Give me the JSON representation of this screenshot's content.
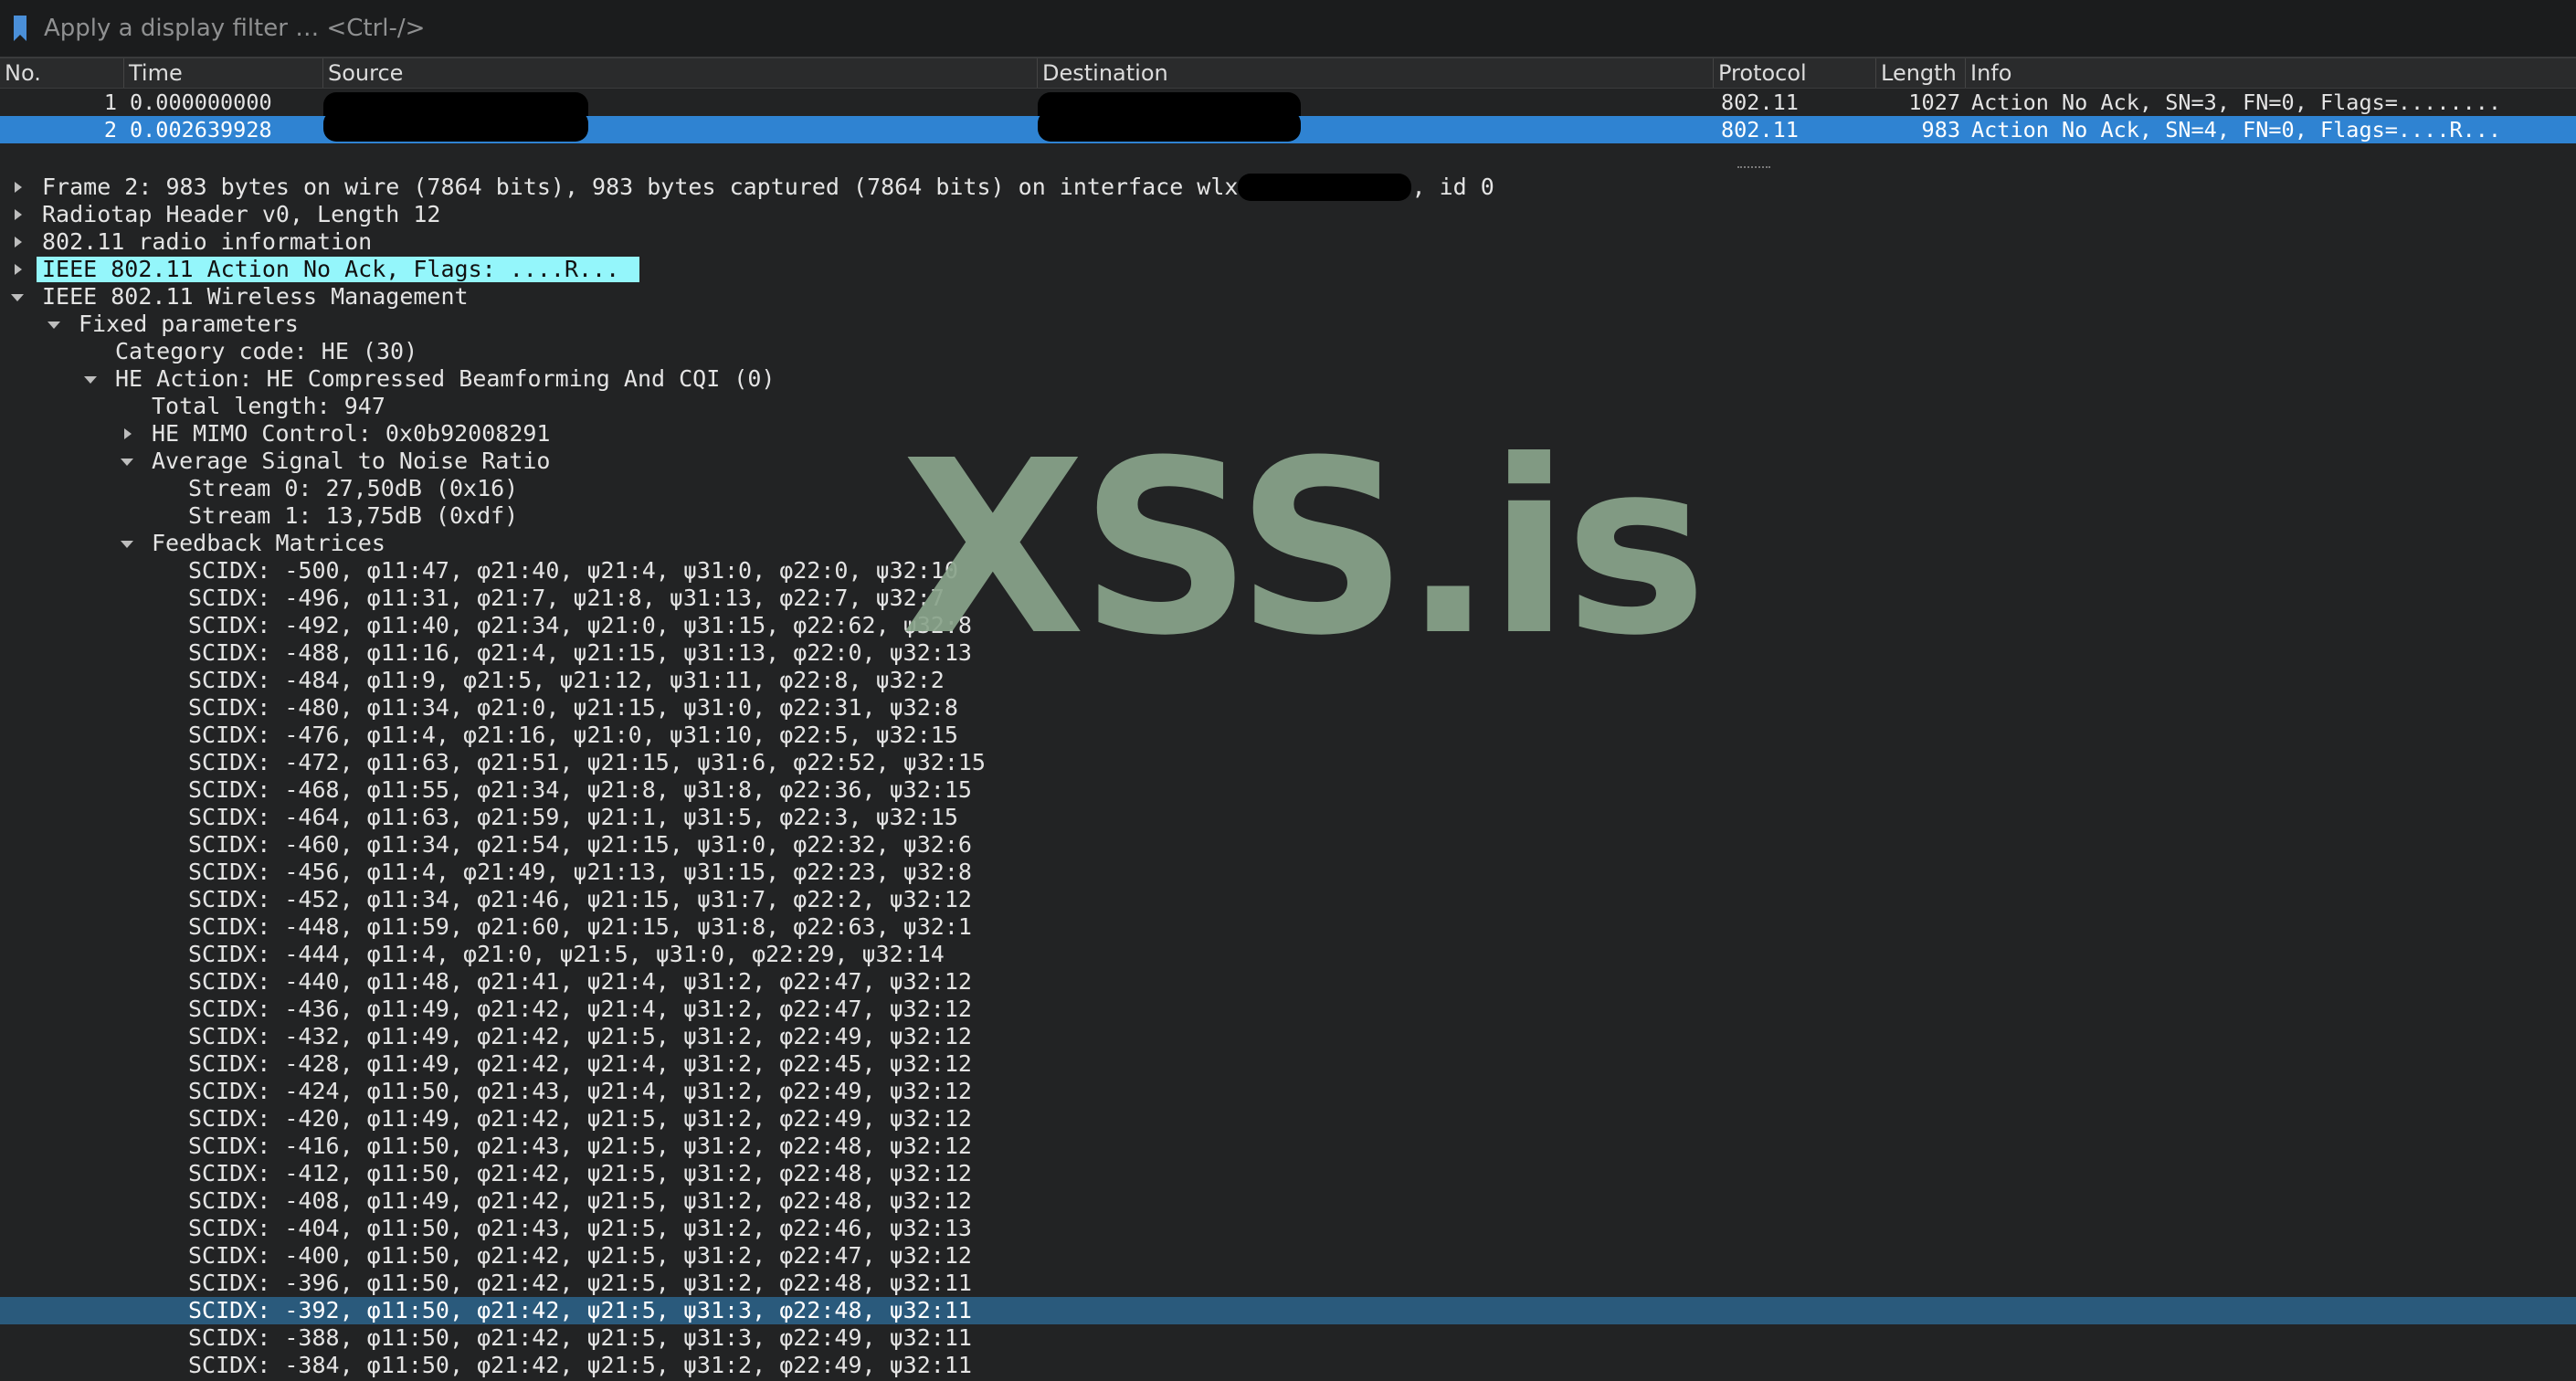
{
  "filter": {
    "placeholder": "Apply a display filter … <Ctrl-/>",
    "icon": "bookmark-icon"
  },
  "packet_list": {
    "columns": [
      "No.",
      "Time",
      "Source",
      "Destination",
      "Protocol",
      "Length",
      "Info"
    ],
    "rows": [
      {
        "no": "1",
        "time": "0.000000000",
        "source": "",
        "destination": "",
        "protocol": "802.11",
        "length": "1027",
        "info": "Action No Ack, SN=3, FN=0, Flags=........"
      },
      {
        "no": "2",
        "time": "0.002639928",
        "source": "",
        "destination": "",
        "protocol": "802.11",
        "length": "983",
        "info": "Action No Ack, SN=4, FN=0, Flags=....R..."
      }
    ]
  },
  "details": {
    "frame": "Frame 2: 983 bytes on wire (7864 bits), 983 bytes captured (7864 bits) on interface wlx",
    "frame_suffix": ", id 0",
    "radiotap": "Radiotap Header v0, Length 12",
    "radio_info": "802.11 radio information",
    "action": "IEEE 802.11 Action No Ack, Flags: ....R...",
    "wireless_mgmt": "IEEE 802.11 Wireless Management",
    "fixed_params": "Fixed parameters",
    "category": "Category code: HE (30)",
    "he_action": "HE Action: HE Compressed Beamforming And CQI (0)",
    "total_length": "Total length: 947",
    "mimo_control": "HE MIMO Control: 0x0b92008291",
    "avg_snr": "Average Signal to Noise Ratio",
    "stream0": "Stream 0: 27,50dB (0x16)",
    "stream1": "Stream 1: 13,75dB (0xdf)",
    "feedback": "Feedback Matrices",
    "scidx": [
      "SCIDX: -500, φ11:47, φ21:40, ψ21:4, ψ31:0, φ22:0, ψ32:10",
      "SCIDX: -496, φ11:31, φ21:7, ψ21:8, ψ31:13, φ22:7, ψ32:7",
      "SCIDX: -492, φ11:40, φ21:34, ψ21:0, ψ31:15, φ22:62, ψ32:8",
      "SCIDX: -488, φ11:16, φ21:4, ψ21:15, ψ31:13, φ22:0, ψ32:13",
      "SCIDX: -484, φ11:9, φ21:5, ψ21:12, ψ31:11, φ22:8, ψ32:2",
      "SCIDX: -480, φ11:34, φ21:0, ψ21:15, ψ31:0, φ22:31, ψ32:8",
      "SCIDX: -476, φ11:4, φ21:16, ψ21:0, ψ31:10, φ22:5, ψ32:15",
      "SCIDX: -472, φ11:63, φ21:51, ψ21:15, ψ31:6, φ22:52, ψ32:15",
      "SCIDX: -468, φ11:55, φ21:34, ψ21:8, ψ31:8, φ22:36, ψ32:15",
      "SCIDX: -464, φ11:63, φ21:59, ψ21:1, ψ31:5, φ22:3, ψ32:15",
      "SCIDX: -460, φ11:34, φ21:54, ψ21:15, ψ31:0, φ22:32, ψ32:6",
      "SCIDX: -456, φ11:4, φ21:49, ψ21:13, ψ31:15, φ22:23, ψ32:8",
      "SCIDX: -452, φ11:34, φ21:46, ψ21:15, ψ31:7, φ22:2, ψ32:12",
      "SCIDX: -448, φ11:59, φ21:60, ψ21:15, ψ31:8, φ22:63, ψ32:1",
      "SCIDX: -444, φ11:4, φ21:0, ψ21:5, ψ31:0, φ22:29, ψ32:14",
      "SCIDX: -440, φ11:48, φ21:41, ψ21:4, ψ31:2, φ22:47, ψ32:12",
      "SCIDX: -436, φ11:49, φ21:42, ψ21:4, ψ31:2, φ22:47, ψ32:12",
      "SCIDX: -432, φ11:49, φ21:42, ψ21:5, ψ31:2, φ22:49, ψ32:12",
      "SCIDX: -428, φ11:49, φ21:42, ψ21:4, ψ31:2, φ22:45, ψ32:12",
      "SCIDX: -424, φ11:50, φ21:43, ψ21:4, ψ31:2, φ22:49, ψ32:12",
      "SCIDX: -420, φ11:49, φ21:42, ψ21:5, ψ31:2, φ22:49, ψ32:12",
      "SCIDX: -416, φ11:50, φ21:43, ψ21:5, ψ31:2, φ22:48, ψ32:12",
      "SCIDX: -412, φ11:50, φ21:42, ψ21:5, ψ31:2, φ22:48, ψ32:12",
      "SCIDX: -408, φ11:49, φ21:42, ψ21:5, ψ31:2, φ22:48, ψ32:12",
      "SCIDX: -404, φ11:50, φ21:43, ψ21:5, ψ31:2, φ22:46, ψ32:13",
      "SCIDX: -400, φ11:50, φ21:42, ψ21:5, ψ31:2, φ22:47, ψ32:12",
      "SCIDX: -396, φ11:50, φ21:42, ψ21:5, ψ31:2, φ22:48, ψ32:11",
      "SCIDX: -392, φ11:50, φ21:42, ψ21:5, ψ31:3, φ22:48, ψ32:11",
      "SCIDX: -388, φ11:50, φ21:42, ψ21:5, ψ31:3, φ22:49, ψ32:11",
      "SCIDX: -384, φ11:50, φ21:42, ψ21:5, ψ31:2, φ22:49, ψ32:11"
    ]
  },
  "watermark": "XSS.is",
  "colors": {
    "selected_packet": "#2f83d2",
    "highlight_cyan": "#94f6fb",
    "selected_detail": "#2a5a7c",
    "watermark": "#8aa58c"
  }
}
